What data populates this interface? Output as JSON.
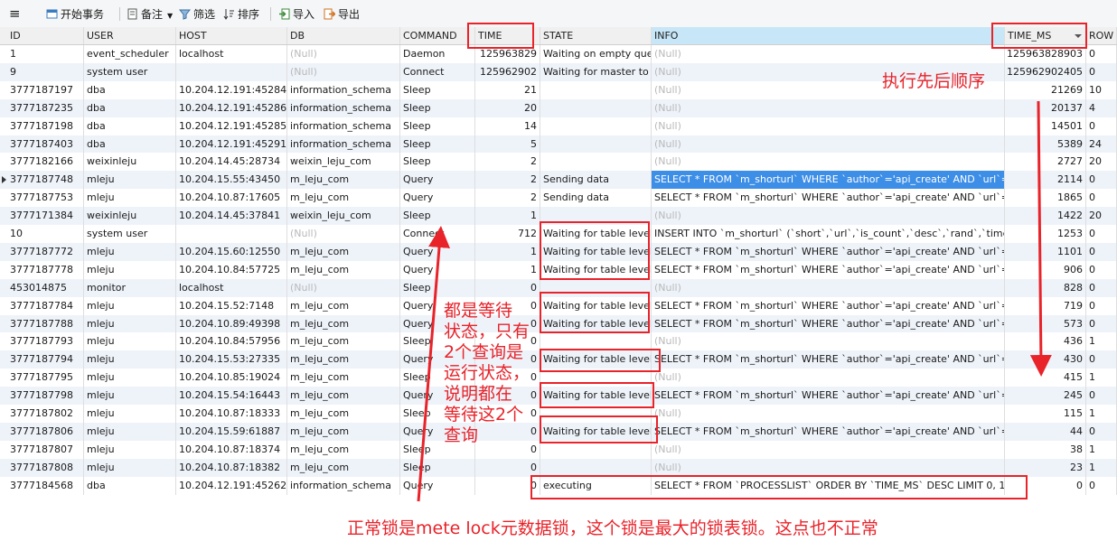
{
  "toolbar": {
    "items": [
      {
        "label": "开始事务",
        "icon": "transaction-icon"
      },
      {
        "label": "备注",
        "icon": "note-icon"
      },
      {
        "label": "筛选",
        "icon": "filter-icon"
      },
      {
        "label": "排序",
        "icon": "sort-icon"
      },
      {
        "label": "导入",
        "icon": "import-icon"
      },
      {
        "label": "导出",
        "icon": "export-icon"
      }
    ]
  },
  "grid": {
    "columns": [
      "ID",
      "USER",
      "HOST",
      "DB",
      "COMMAND",
      "TIME",
      "STATE",
      "INFO",
      "TIME_MS",
      "ROW"
    ],
    "rows": [
      [
        "1",
        "event_scheduler",
        "localhost",
        "(Null)",
        "Daemon",
        "125963829",
        "Waiting on empty queue",
        "(Null)",
        "125963828903",
        "0"
      ],
      [
        "9",
        "system user",
        "",
        "(Null)",
        "Connect",
        "125962902",
        "Waiting for master to send event",
        "(Null)",
        "125962902405",
        "0"
      ],
      [
        "3777187197",
        "dba",
        "10.204.12.191:45284",
        "information_schema",
        "Sleep",
        "21",
        "",
        "(Null)",
        "21269",
        "10"
      ],
      [
        "3777187235",
        "dba",
        "10.204.12.191:45286",
        "information_schema",
        "Sleep",
        "20",
        "",
        "(Null)",
        "20137",
        "4"
      ],
      [
        "3777187198",
        "dba",
        "10.204.12.191:45285",
        "information_schema",
        "Sleep",
        "14",
        "",
        "(Null)",
        "14501",
        "0"
      ],
      [
        "3777187403",
        "dba",
        "10.204.12.191:45291",
        "information_schema",
        "Sleep",
        "5",
        "",
        "(Null)",
        "5389",
        "24"
      ],
      [
        "3777182166",
        "weixinleju",
        "10.204.14.45:28734",
        "weixin_leju_com",
        "Sleep",
        "2",
        "",
        "(Null)",
        "2727",
        "20"
      ],
      [
        "3777187748",
        "mleju",
        "10.204.15.55:43450",
        "m_leju_com",
        "Query",
        "2",
        "Sending data",
        "SELECT * FROM `m_shorturl`  WHERE  `author`='api_create' AND `url`='http:",
        "2114",
        "0"
      ],
      [
        "3777187753",
        "mleju",
        "10.204.10.87:17605",
        "m_leju_com",
        "Query",
        "2",
        "Sending data",
        "SELECT * FROM `m_shorturl`  WHERE  `author`='api_create' AND `url`='http:",
        "1865",
        "0"
      ],
      [
        "3777171384",
        "weixinleju",
        "10.204.14.45:37841",
        "weixin_leju_com",
        "Sleep",
        "1",
        "",
        "(Null)",
        "1422",
        "20"
      ],
      [
        "10",
        "system user",
        "",
        "(Null)",
        "Connect",
        "712",
        "Waiting for table level lock",
        "INSERT INTO `m_shorturl` (`short`,`url`,`is_count`,`desc`,`rand`,`time`,`author`,",
        "1253",
        "0"
      ],
      [
        "3777187772",
        "mleju",
        "10.204.15.60:12550",
        "m_leju_com",
        "Query",
        "1",
        "Waiting for table level lock",
        "SELECT * FROM `m_shorturl`  WHERE  `author`='api_create' AND `url`='http:",
        "1101",
        "0"
      ],
      [
        "3777187778",
        "mleju",
        "10.204.10.84:57725",
        "m_leju_com",
        "Query",
        "1",
        "Waiting for table level lock",
        "SELECT * FROM `m_shorturl`  WHERE  `author`='api_create' AND `url`='http:",
        "906",
        "0"
      ],
      [
        "453014875",
        "monitor",
        "localhost",
        "(Null)",
        "Sleep",
        "0",
        "",
        "(Null)",
        "828",
        "0"
      ],
      [
        "3777187784",
        "mleju",
        "10.204.15.52:7148",
        "m_leju_com",
        "Query",
        "0",
        "Waiting for table level lock",
        "SELECT * FROM `m_shorturl`  WHERE  `author`='api_create' AND `url`='http:",
        "719",
        "0"
      ],
      [
        "3777187788",
        "mleju",
        "10.204.10.89:49398",
        "m_leju_com",
        "Query",
        "0",
        "Waiting for table level lock",
        "SELECT * FROM `m_shorturl`  WHERE  `author`='api_create' AND `url`='http:",
        "573",
        "0"
      ],
      [
        "3777187793",
        "mleju",
        "10.204.10.84:57956",
        "m_leju_com",
        "Sleep",
        "0",
        "",
        "(Null)",
        "436",
        "1"
      ],
      [
        "3777187794",
        "mleju",
        "10.204.15.53:27335",
        "m_leju_com",
        "Query",
        "0",
        "Waiting for table level lock",
        "SELECT * FROM `m_shorturl`  WHERE  `author`='api_create' AND `url`='http:",
        "430",
        "0"
      ],
      [
        "3777187795",
        "mleju",
        "10.204.10.85:19024",
        "m_leju_com",
        "Sleep",
        "0",
        "",
        "(Null)",
        "415",
        "1"
      ],
      [
        "3777187798",
        "mleju",
        "10.204.15.54:16443",
        "m_leju_com",
        "Query",
        "0",
        "Waiting for table level lock",
        "SELECT * FROM `m_shorturl`  WHERE  `author`='api_create' AND `url`='http:",
        "245",
        "0"
      ],
      [
        "3777187802",
        "mleju",
        "10.204.10.87:18333",
        "m_leju_com",
        "Sleep",
        "0",
        "",
        "(Null)",
        "115",
        "1"
      ],
      [
        "3777187806",
        "mleju",
        "10.204.15.59:61887",
        "m_leju_com",
        "Query",
        "0",
        "Waiting for table level lock",
        "SELECT * FROM `m_shorturl`  WHERE  `author`='api_create' AND `url`='http:",
        "44",
        "0"
      ],
      [
        "3777187807",
        "mleju",
        "10.204.10.87:18374",
        "m_leju_com",
        "Sleep",
        "0",
        "",
        "(Null)",
        "38",
        "1"
      ],
      [
        "3777187808",
        "mleju",
        "10.204.10.87:18382",
        "m_leju_com",
        "Sleep",
        "0",
        "",
        "(Null)",
        "23",
        "1"
      ],
      [
        "3777184568",
        "dba",
        "10.204.12.191:45262",
        "information_schema",
        "Query",
        "0",
        "executing",
        "SELECT * FROM `PROCESSLIST` ORDER BY `TIME_MS` DESC LIMIT 0, 1000",
        "0",
        "0"
      ]
    ],
    "current_row": 7
  },
  "annotations": {
    "order_note": "执行先后顺序",
    "wait_note_lines": [
      "都是等待",
      "状态，只有",
      "2个查询是",
      "运行状态，",
      "说明都在",
      "等待这2个",
      "查询"
    ],
    "lock_note": "正常锁是mete lock元数据锁，这个锁是最大的锁表锁。这点也不正常",
    "color": "#e8232a"
  }
}
